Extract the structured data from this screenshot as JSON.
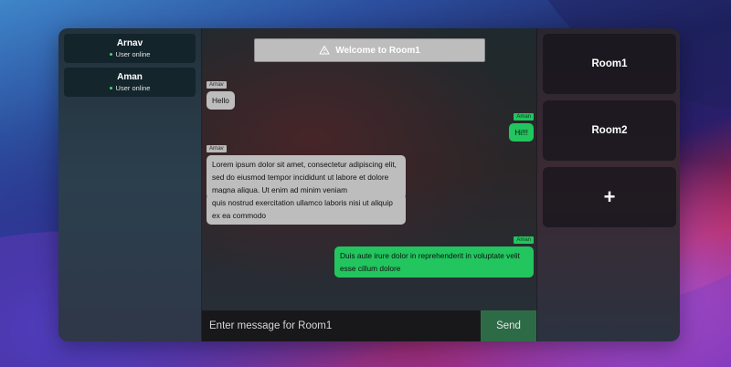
{
  "users": [
    {
      "name": "Arnav",
      "status": "User online"
    },
    {
      "name": "Aman",
      "status": "User online"
    }
  ],
  "chat": {
    "welcome": "Welcome to Room1",
    "messages": [
      {
        "sender": "Arnav",
        "side": "left",
        "text": "Hello"
      },
      {
        "sender": "Aman",
        "side": "right",
        "text": "Hi!!!"
      },
      {
        "sender": "Arnav",
        "side": "left",
        "text": "Lorem ipsum dolor sit amet, consectetur adipiscing elit, sed do eiusmod tempor incididunt ut labore et dolore magna aliqua. Ut enim ad minim veniam"
      },
      {
        "sender": "",
        "side": "left",
        "text": "quis nostrud exercitation ullamco laboris nisi ut aliquip ex ea commodo"
      },
      {
        "sender": "Aman",
        "side": "right",
        "text": "Duis aute irure dolor in reprehenderit in voluptate velit esse cillum dolore"
      }
    ],
    "input_placeholder": "Enter message for Room1",
    "send_label": "Send"
  },
  "rooms": [
    {
      "name": "Room1"
    },
    {
      "name": "Room2"
    }
  ],
  "add_room_label": "+",
  "colors": {
    "accent_green": "#22c55e",
    "bubble_gray": "#bdbdbd",
    "send_button": "#2d6b47"
  }
}
